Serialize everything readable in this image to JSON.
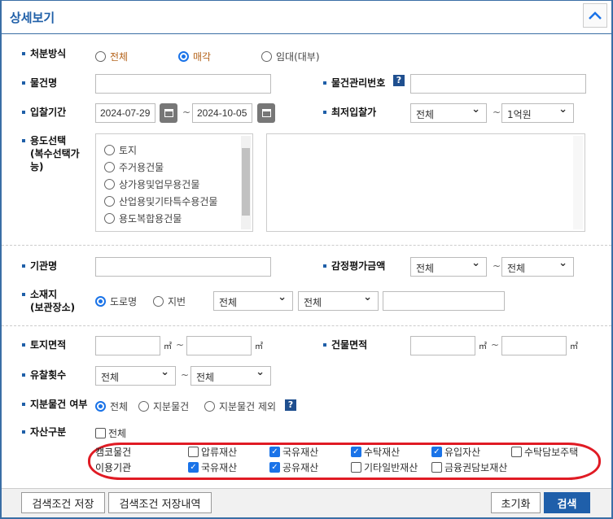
{
  "header": {
    "title": "상세보기",
    "collapse_icon": "chevron-up-icon"
  },
  "disposal": {
    "label": "처분방식",
    "options": [
      "전체",
      "매각",
      "임대(대부)"
    ],
    "selected": "매각"
  },
  "item_name": {
    "label": "물건명",
    "value": ""
  },
  "item_mgmt_no": {
    "label": "물건관리번호",
    "help": "?",
    "value": ""
  },
  "bid_period": {
    "label": "입찰기간",
    "from": "2024-07-29",
    "to": "2024-10-05",
    "sep": "~"
  },
  "min_bid": {
    "label": "최저입찰가",
    "from": "전체",
    "to": "1억원",
    "sep": "~"
  },
  "usage": {
    "label_lines": [
      "용도선택",
      "(복수선택가",
      "능)"
    ],
    "options": [
      "토지",
      "주거용건물",
      "상가용및업무용건물",
      "산업용및기타특수용건물",
      "용도복합용건물"
    ]
  },
  "agency": {
    "label": "기관명",
    "value": ""
  },
  "appraisal": {
    "label": "감정평가금액",
    "from": "전체",
    "to": "전체",
    "sep": "~"
  },
  "location": {
    "label_lines": [
      "소재지",
      "(보관장소)"
    ],
    "options": [
      "도로명",
      "지번"
    ],
    "selected": "도로명",
    "select1": "전체",
    "select2": "전체",
    "value": ""
  },
  "land_area": {
    "label": "토지면적",
    "unit": "㎡",
    "sep": "~"
  },
  "building_area": {
    "label": "건물면적",
    "unit": "㎡",
    "sep": "~"
  },
  "fail_count": {
    "label": "유찰횟수",
    "from": "전체",
    "to": "전체",
    "sep": "~"
  },
  "share": {
    "label": "지분물건 여부",
    "options": [
      "전체",
      "지분물건",
      "지분물건 제외"
    ],
    "selected": "전체",
    "help": "?"
  },
  "asset": {
    "label": "자산구분",
    "all": "전체",
    "all_checked": false,
    "rows": [
      {
        "label": "캠코물건",
        "items": [
          {
            "label": "압류재산",
            "checked": false
          },
          {
            "label": "국유재산",
            "checked": true
          },
          {
            "label": "수탁재산",
            "checked": true
          },
          {
            "label": "유입자산",
            "checked": true
          },
          {
            "label": "수탁담보주택",
            "checked": false
          }
        ]
      },
      {
        "label": "이용기관",
        "items": [
          {
            "label": "국유재산",
            "checked": true
          },
          {
            "label": "공유재산",
            "checked": true
          },
          {
            "label": "기타일반재산",
            "checked": false
          },
          {
            "label": "금융권담보재산",
            "checked": false
          }
        ]
      }
    ]
  },
  "footer": {
    "save": "검색조건 저장",
    "history": "검색조건 저장내역",
    "reset": "초기화",
    "search": "검색"
  },
  "colors": {
    "accent": "#1f5fa8",
    "search_button": "#1f5faa",
    "highlight": "#e01b24"
  }
}
